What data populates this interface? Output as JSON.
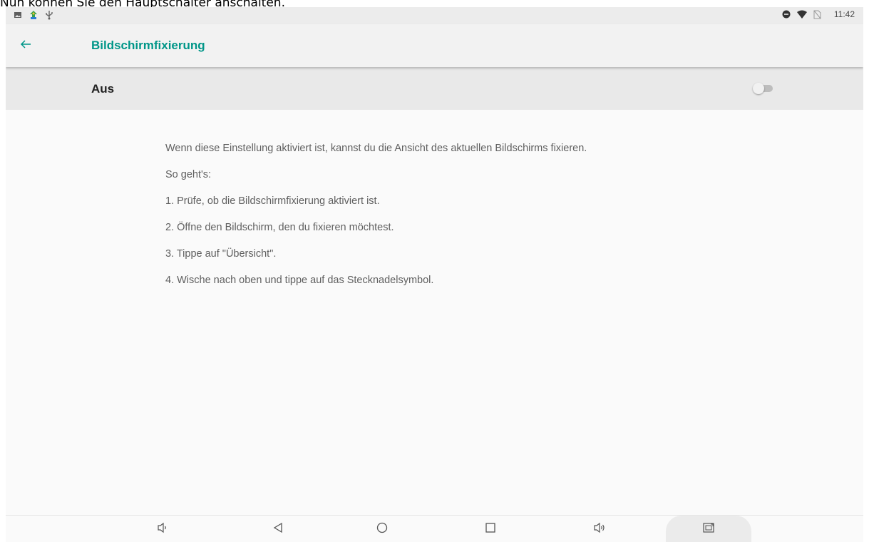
{
  "caption": "Nun können Sie den Hauptschalter anschalten.",
  "status_bar": {
    "left_icons": [
      "image-notification-icon",
      "app-notification-icon",
      "usb-icon"
    ],
    "right_icons": [
      "do-not-disturb-icon",
      "wifi-icon",
      "no-sim-icon"
    ],
    "time": "11:42"
  },
  "app_bar": {
    "title": "Bildschirmfixierung",
    "back_icon": "arrow-back-icon"
  },
  "master_switch": {
    "label": "Aus",
    "state": "off"
  },
  "description": {
    "lines": [
      "Wenn diese Einstellung aktiviert ist, kannst du die Ansicht des aktuellen Bildschirms fixieren.",
      "So geht's:",
      "1. Prüfe, ob die Bildschirmfixierung aktiviert ist.",
      "2. Öffne den Bildschirm, den du fixieren möchtest.",
      "3. Tippe auf \"Übersicht\".",
      "4. Wische nach oben und tippe auf das Stecknadelsymbol."
    ]
  },
  "nav_bar": {
    "buttons": [
      "volume-down-icon",
      "back-triangle-icon",
      "home-circle-icon",
      "overview-square-icon",
      "volume-up-icon",
      "screenshot-icon"
    ]
  },
  "colors": {
    "accent": "#009688",
    "text_primary": "#212121",
    "text_secondary": "#5f5f5f"
  }
}
